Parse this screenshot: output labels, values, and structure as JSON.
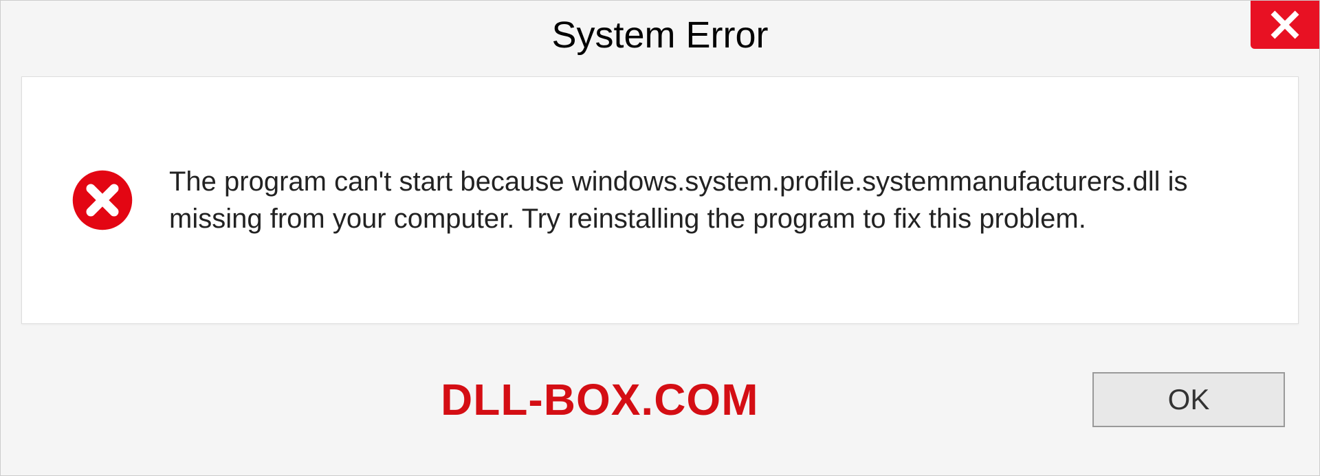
{
  "dialog": {
    "title": "System Error",
    "message": "The program can't start because windows.system.profile.systemmanufacturers.dll is missing from your computer. Try reinstalling the program to fix this problem.",
    "ok_label": "OK"
  },
  "watermark": "DLL-BOX.COM"
}
